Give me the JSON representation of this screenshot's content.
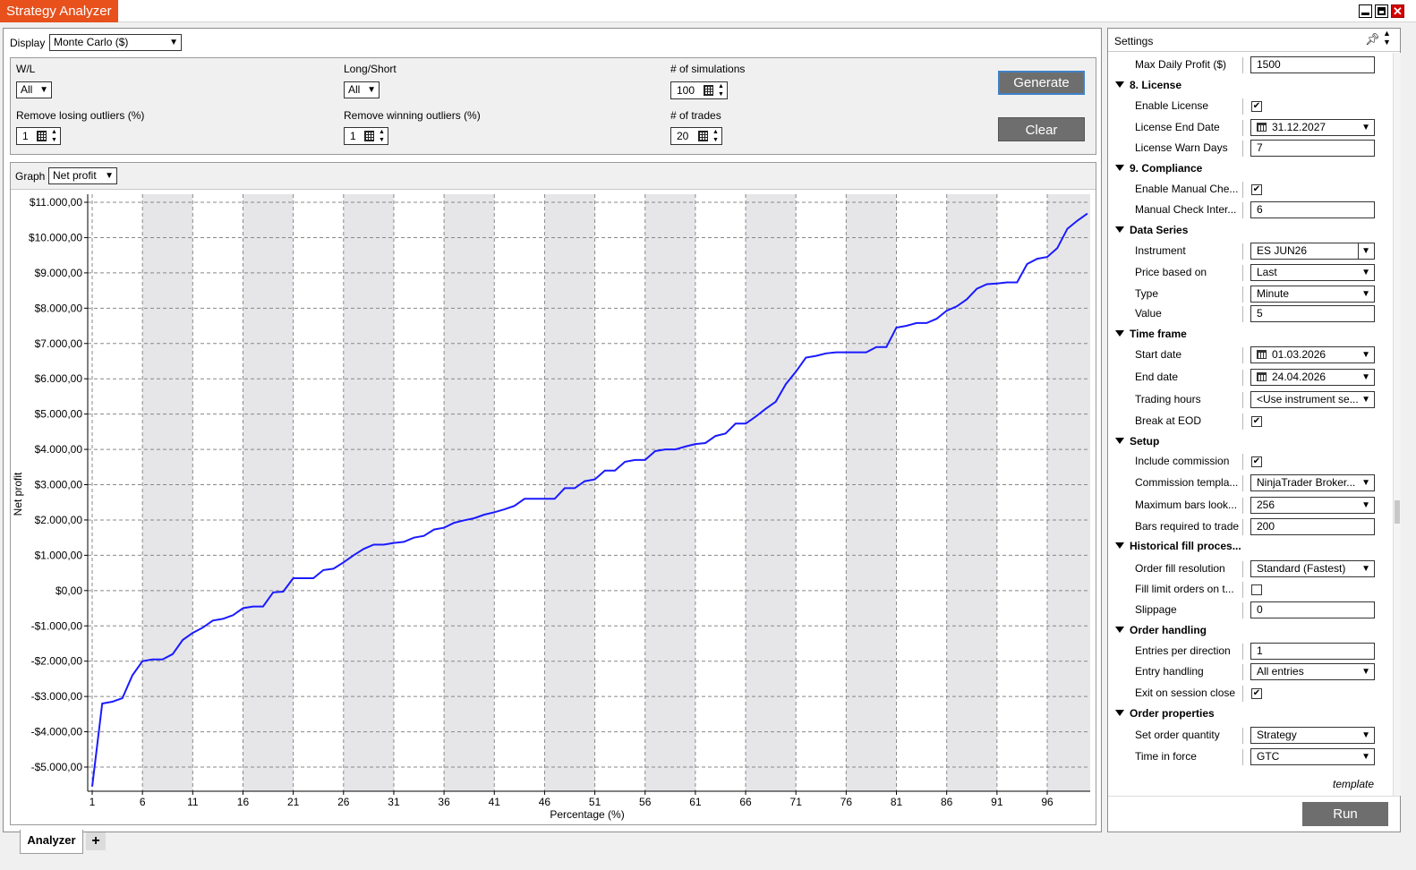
{
  "window": {
    "title": "Strategy Analyzer"
  },
  "display": {
    "label": "Display",
    "value": "Monte Carlo ($)"
  },
  "filters": {
    "wl": {
      "label": "W/L",
      "value": "All"
    },
    "long_short": {
      "label": "Long/Short",
      "value": "All"
    },
    "num_simulations": {
      "label": "# of simulations",
      "value": "100"
    },
    "remove_losing": {
      "label": "Remove losing outliers (%)",
      "value": "1"
    },
    "remove_winning": {
      "label": "Remove winning outliers (%)",
      "value": "1"
    },
    "num_trades": {
      "label": "# of trades",
      "value": "20"
    },
    "generate_label": "Generate",
    "clear_label": "Clear"
  },
  "graph": {
    "label": "Graph",
    "value": "Net profit"
  },
  "chart_data": {
    "type": "line",
    "xlabel": "Percentage (%)",
    "ylabel": "Net profit",
    "xlim": [
      1,
      100
    ],
    "ylim": [
      -5600,
      11100
    ],
    "x_ticks": [
      1,
      6,
      11,
      16,
      21,
      26,
      31,
      36,
      41,
      46,
      51,
      56,
      61,
      66,
      71,
      76,
      81,
      86,
      91,
      96
    ],
    "x_tick_labels": [
      "1",
      "6",
      "11",
      "16",
      "21",
      "26",
      "31",
      "36",
      "41",
      "46",
      "51",
      "56",
      "61",
      "66",
      "71",
      "76",
      "81",
      "86",
      "91",
      "96"
    ],
    "y_ticks": [
      11000,
      10000,
      9000,
      8000,
      7000,
      6000,
      5000,
      4000,
      3000,
      2000,
      1000,
      0,
      -1000,
      -2000,
      -3000,
      -4000,
      -5000
    ],
    "y_tick_labels": [
      "$11.000,00",
      "$10.000,00",
      "$9.000,00",
      "$8.000,00",
      "$7.000,00",
      "$6.000,00",
      "$5.000,00",
      "$4.000,00",
      "$3.000,00",
      "$2.000,00",
      "$1.000,00",
      "$0,00",
      "-$1.000,00",
      "-$2.000,00",
      "-$3.000,00",
      "-$4.000,00",
      "-$5.000,00"
    ],
    "grid": true,
    "line_color": "#1a1aff",
    "x": [
      1,
      2,
      3,
      4,
      5,
      6,
      7,
      8,
      9,
      10,
      11,
      12,
      13,
      14,
      15,
      16,
      17,
      18,
      19,
      20,
      21,
      22,
      23,
      24,
      25,
      26,
      27,
      28,
      29,
      30,
      31,
      32,
      33,
      34,
      35,
      36,
      37,
      38,
      39,
      40,
      41,
      42,
      43,
      44,
      45,
      46,
      47,
      48,
      49,
      50,
      51,
      52,
      53,
      54,
      55,
      56,
      57,
      58,
      59,
      60,
      61,
      62,
      63,
      64,
      65,
      66,
      67,
      68,
      69,
      70,
      71,
      72,
      73,
      74,
      75,
      76,
      77,
      78,
      79,
      80,
      81,
      82,
      83,
      84,
      85,
      86,
      87,
      88,
      89,
      90,
      91,
      92,
      93,
      94,
      95,
      96,
      97,
      98,
      99,
      100
    ],
    "values": [
      -5550,
      -3200,
      -3150,
      -3050,
      -2400,
      -2000,
      -1950,
      -1950,
      -1800,
      -1400,
      -1200,
      -1050,
      -850,
      -800,
      -700,
      -500,
      -450,
      -450,
      -50,
      -30,
      350,
      350,
      350,
      580,
      620,
      800,
      1000,
      1180,
      1300,
      1300,
      1350,
      1380,
      1500,
      1550,
      1730,
      1780,
      1920,
      1990,
      2050,
      2150,
      2220,
      2300,
      2400,
      2600,
      2600,
      2600,
      2600,
      2900,
      2900,
      3100,
      3150,
      3400,
      3400,
      3650,
      3700,
      3700,
      3950,
      4000,
      4000,
      4080,
      4150,
      4180,
      4380,
      4450,
      4730,
      4730,
      4930,
      5150,
      5350,
      5850,
      6200,
      6600,
      6650,
      6720,
      6750,
      6750,
      6750,
      6750,
      6900,
      6900,
      7450,
      7500,
      7580,
      7580,
      7700,
      7930,
      8050,
      8250,
      8550,
      8680,
      8700,
      8730,
      8730,
      9250,
      9400,
      9450,
      9700,
      10250,
      10480,
      10680,
      11050
    ]
  },
  "settings": {
    "title": "Settings",
    "rows": [
      {
        "kind": "prop",
        "name": "Max Daily Profit ($)",
        "type": "text",
        "value": "1500"
      },
      {
        "kind": "cat",
        "name": "8. License"
      },
      {
        "kind": "prop",
        "name": "Enable License",
        "type": "check",
        "checked": true
      },
      {
        "kind": "prop",
        "name": "License End Date",
        "type": "date",
        "value": "31.12.2027"
      },
      {
        "kind": "prop",
        "name": "License Warn Days",
        "type": "text",
        "value": "7"
      },
      {
        "kind": "cat",
        "name": "9. Compliance"
      },
      {
        "kind": "prop",
        "name": "Enable Manual Che...",
        "type": "check",
        "checked": true
      },
      {
        "kind": "prop",
        "name": "Manual Check Inter...",
        "type": "text",
        "value": "6"
      },
      {
        "kind": "cat",
        "name": "Data Series"
      },
      {
        "kind": "prop",
        "name": "Instrument",
        "type": "combo",
        "value": "ES JUN26"
      },
      {
        "kind": "prop",
        "name": "Price based on",
        "type": "dropdown",
        "value": "Last"
      },
      {
        "kind": "prop",
        "name": "Type",
        "type": "dropdown",
        "value": "Minute"
      },
      {
        "kind": "prop",
        "name": "Value",
        "type": "text",
        "value": "5"
      },
      {
        "kind": "cat",
        "name": "Time frame"
      },
      {
        "kind": "prop",
        "name": "Start date",
        "type": "date",
        "value": "01.03.2026"
      },
      {
        "kind": "prop",
        "name": "End date",
        "type": "date",
        "value": "24.04.2026"
      },
      {
        "kind": "prop",
        "name": "Trading hours",
        "type": "dropdown",
        "value": "<Use instrument se..."
      },
      {
        "kind": "prop",
        "name": "Break at EOD",
        "type": "check",
        "checked": true
      },
      {
        "kind": "cat",
        "name": "Setup"
      },
      {
        "kind": "prop",
        "name": "Include commission",
        "type": "check",
        "checked": true
      },
      {
        "kind": "prop",
        "name": "Commission templa...",
        "type": "dropdown",
        "value": "NinjaTrader Broker..."
      },
      {
        "kind": "prop",
        "name": "Maximum bars look...",
        "type": "dropdown",
        "value": "256"
      },
      {
        "kind": "prop",
        "name": "Bars required to trade",
        "type": "text",
        "value": "200"
      },
      {
        "kind": "cat",
        "name": "Historical fill proces..."
      },
      {
        "kind": "prop",
        "name": "Order fill resolution",
        "type": "dropdown",
        "value": "Standard (Fastest)"
      },
      {
        "kind": "prop",
        "name": "Fill limit orders on t...",
        "type": "check",
        "checked": false
      },
      {
        "kind": "prop",
        "name": "Slippage",
        "type": "text",
        "value": "0"
      },
      {
        "kind": "cat",
        "name": "Order handling"
      },
      {
        "kind": "prop",
        "name": "Entries per direction",
        "type": "text",
        "value": "1"
      },
      {
        "kind": "prop",
        "name": "Entry handling",
        "type": "dropdown",
        "value": "All entries"
      },
      {
        "kind": "prop",
        "name": "Exit on session close",
        "type": "check",
        "checked": true
      },
      {
        "kind": "cat",
        "name": "Order properties"
      },
      {
        "kind": "prop",
        "name": "Set order quantity",
        "type": "dropdown",
        "value": "Strategy"
      },
      {
        "kind": "prop",
        "name": "Time in force",
        "type": "dropdown",
        "value": "GTC"
      }
    ],
    "template_label": "template",
    "run_label": "Run"
  },
  "tabs": {
    "active": "Analyzer",
    "add": "+"
  }
}
